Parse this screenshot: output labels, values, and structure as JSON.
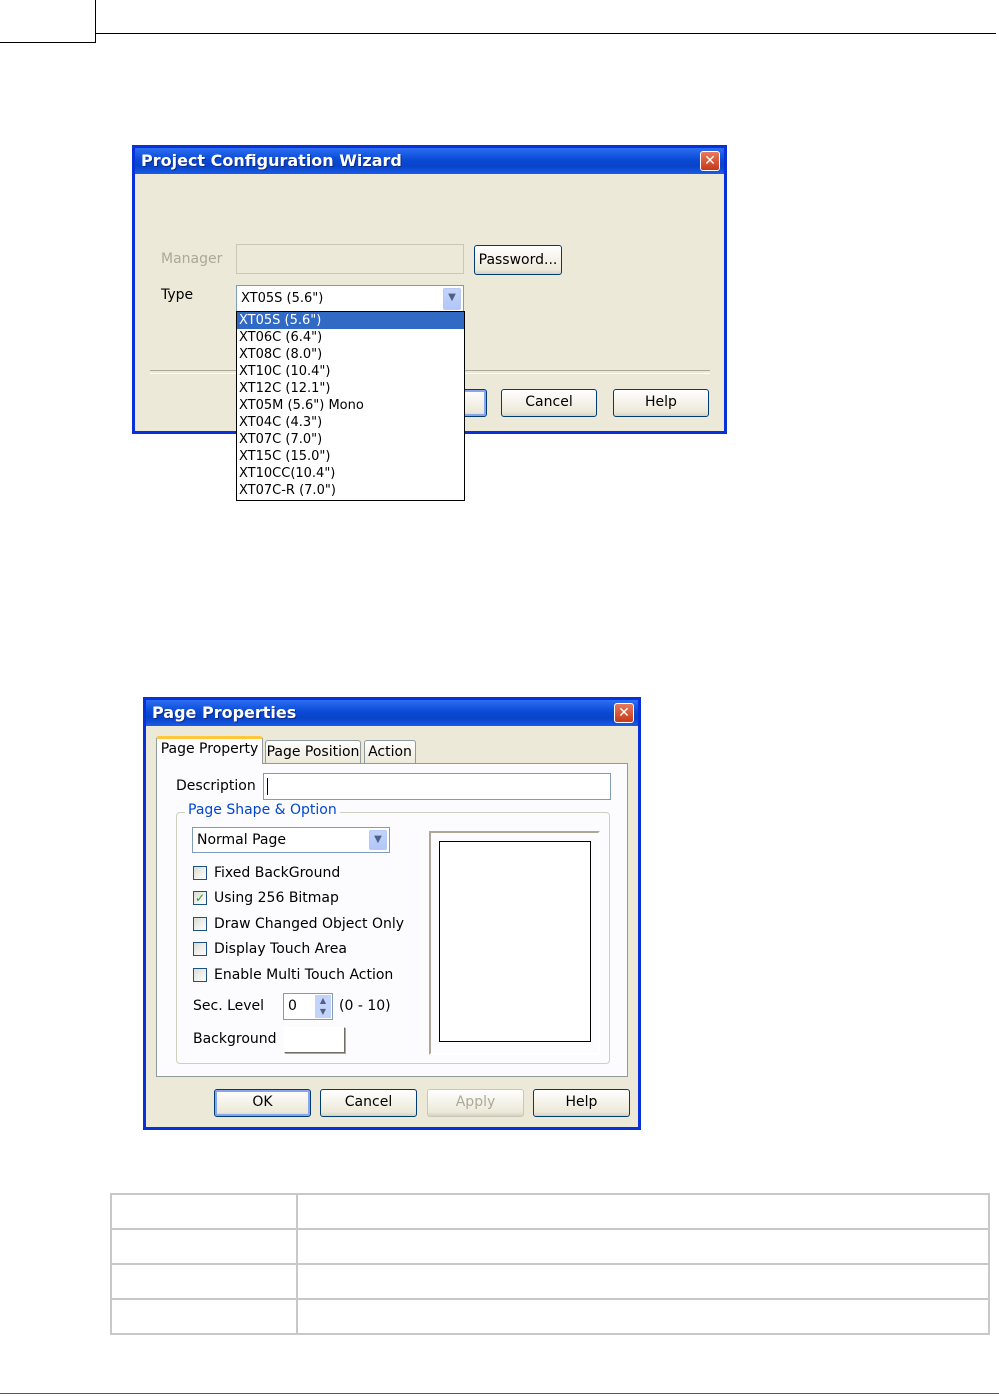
{
  "wizard": {
    "title": "Project Configuration Wizard",
    "close_glyph": "✕",
    "manager_label": "Manager",
    "manager_value": "",
    "password_button": "Password...",
    "type_label": "Type",
    "type_value": "XT05S (5.6\")",
    "type_options": [
      "XT05S (5.6\")",
      "XT06C (6.4\")",
      "XT08C (8.0\")",
      "XT10C (10.4\")",
      "XT12C (12.1\")",
      "XT05M (5.6\") Mono",
      "XT04C (4.3\")",
      "XT07C (7.0\")",
      "XT15C (15.0\")",
      "XT10CC(10.4\")",
      "XT07C-R (7.0\")"
    ],
    "cancel_button": "Cancel",
    "help_button": "Help"
  },
  "props": {
    "title": "Page Properties",
    "close_glyph": "✕",
    "tabs": [
      "Page Property",
      "Page Position",
      "Action"
    ],
    "description_label": "Description",
    "description_value": "",
    "group_label": "Page Shape & Option",
    "shape_value": "Normal Page",
    "checkboxes": [
      {
        "label": "Fixed BackGround",
        "checked": false
      },
      {
        "label": "Using 256 Bitmap",
        "checked": true
      },
      {
        "label": "Draw Changed Object Only",
        "checked": false
      },
      {
        "label": "Display Touch Area",
        "checked": false
      },
      {
        "label": "Enable Multi Touch Action",
        "checked": false
      }
    ],
    "sec_level_label": "Sec. Level",
    "sec_level_value": "0",
    "sec_level_range": "(0 - 10)",
    "background_label": "Background",
    "ok_button": "OK",
    "cancel_button": "Cancel",
    "apply_button": "Apply",
    "help_button": "Help"
  }
}
